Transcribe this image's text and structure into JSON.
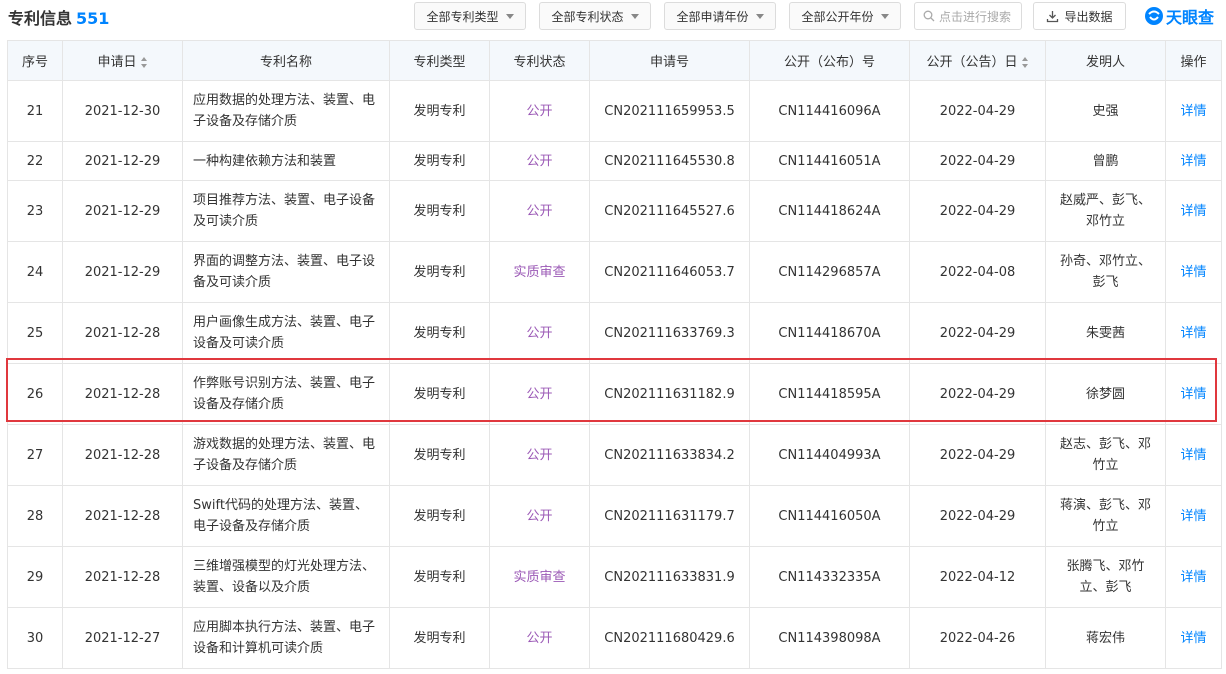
{
  "header": {
    "title": "专利信息",
    "count": "551",
    "filters": [
      "全部专利类型",
      "全部专利状态",
      "全部申请年份",
      "全部公开年份"
    ],
    "search_placeholder": "点击进行搜索",
    "export_label": "导出数据",
    "logo_text": "天眼查"
  },
  "table": {
    "columns": [
      "序号",
      "申请日",
      "专利名称",
      "专利类型",
      "专利状态",
      "申请号",
      "公开（公布）号",
      "公开（公告）日",
      "发明人",
      "操作"
    ],
    "rows": [
      {
        "no": "21",
        "date": "2021-12-30",
        "name": "应用数据的处理方法、装置、电子设备及存储介质",
        "type": "发明专利",
        "status": "公开",
        "app_no": "CN202111659953.5",
        "pub_no": "CN114416096A",
        "pub_date": "2022-04-29",
        "inventor": "史强",
        "action": "详情"
      },
      {
        "no": "22",
        "date": "2021-12-29",
        "name": "一种构建依赖方法和装置",
        "type": "发明专利",
        "status": "公开",
        "app_no": "CN202111645530.8",
        "pub_no": "CN114416051A",
        "pub_date": "2022-04-29",
        "inventor": "曾鹏",
        "action": "详情"
      },
      {
        "no": "23",
        "date": "2021-12-29",
        "name": "项目推荐方法、装置、电子设备及可读介质",
        "type": "发明专利",
        "status": "公开",
        "app_no": "CN202111645527.6",
        "pub_no": "CN114418624A",
        "pub_date": "2022-04-29",
        "inventor": "赵威严、彭飞、邓竹立",
        "action": "详情"
      },
      {
        "no": "24",
        "date": "2021-12-29",
        "name": "界面的调整方法、装置、电子设备及可读介质",
        "type": "发明专利",
        "status": "实质审查",
        "app_no": "CN202111646053.7",
        "pub_no": "CN114296857A",
        "pub_date": "2022-04-08",
        "inventor": "孙奇、邓竹立、彭飞",
        "action": "详情"
      },
      {
        "no": "25",
        "date": "2021-12-28",
        "name": "用户画像生成方法、装置、电子设备及可读介质",
        "type": "发明专利",
        "status": "公开",
        "app_no": "CN202111633769.3",
        "pub_no": "CN114418670A",
        "pub_date": "2022-04-29",
        "inventor": "朱雯茜",
        "action": "详情"
      },
      {
        "no": "26",
        "date": "2021-12-28",
        "name": "作弊账号识别方法、装置、电子设备及存储介质",
        "type": "发明专利",
        "status": "公开",
        "app_no": "CN202111631182.9",
        "pub_no": "CN114418595A",
        "pub_date": "2022-04-29",
        "inventor": "徐梦圆",
        "action": "详情"
      },
      {
        "no": "27",
        "date": "2021-12-28",
        "name": "游戏数据的处理方法、装置、电子设备及存储介质",
        "type": "发明专利",
        "status": "公开",
        "app_no": "CN202111633834.2",
        "pub_no": "CN114404993A",
        "pub_date": "2022-04-29",
        "inventor": "赵志、彭飞、邓竹立",
        "action": "详情"
      },
      {
        "no": "28",
        "date": "2021-12-28",
        "name": "Swift代码的处理方法、装置、电子设备及存储介质",
        "type": "发明专利",
        "status": "公开",
        "app_no": "CN202111631179.7",
        "pub_no": "CN114416050A",
        "pub_date": "2022-04-29",
        "inventor": "蒋演、彭飞、邓竹立",
        "action": "详情"
      },
      {
        "no": "29",
        "date": "2021-12-28",
        "name": "三维增强模型的灯光处理方法、装置、设备以及介质",
        "type": "发明专利",
        "status": "实质审查",
        "app_no": "CN202111633831.9",
        "pub_no": "CN114332335A",
        "pub_date": "2022-04-12",
        "inventor": "张腾飞、邓竹立、彭飞",
        "action": "详情"
      },
      {
        "no": "30",
        "date": "2021-12-27",
        "name": "应用脚本执行方法、装置、电子设备和计算机可读介质",
        "type": "发明专利",
        "status": "公开",
        "app_no": "CN202111680429.6",
        "pub_no": "CN114398098A",
        "pub_date": "2022-04-26",
        "inventor": "蒋宏伟",
        "action": "详情"
      }
    ]
  },
  "colors": {
    "accent": "#0084ff",
    "status": "#9b59b6",
    "highlight": "#e0383e",
    "header_bg": "#f4f8fc"
  }
}
